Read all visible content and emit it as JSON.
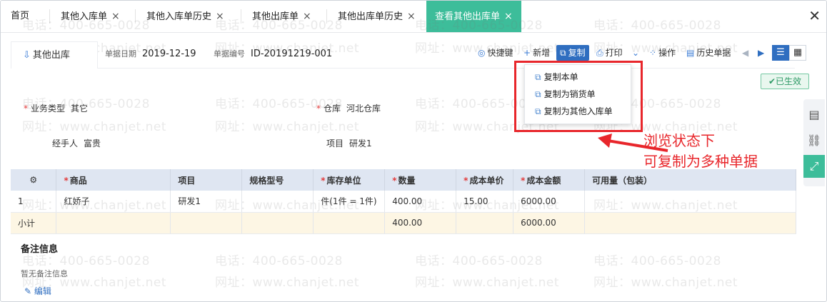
{
  "tabs": [
    {
      "label": "首页",
      "closable": false
    },
    {
      "label": "其他入库单",
      "closable": true
    },
    {
      "label": "其他入库单历史",
      "closable": true
    },
    {
      "label": "其他出库单",
      "closable": true
    },
    {
      "label": "其他出库单历史",
      "closable": true
    },
    {
      "label": "查看其他出库单",
      "closable": true,
      "active": true
    }
  ],
  "tab_close_glyph": "×",
  "window_close_glyph": "✕",
  "watermark": {
    "phone": "电话：400-665-0028",
    "site": "网址：www.chanjet.net"
  },
  "doc": {
    "title": "其他出库",
    "date_label": "单据日期",
    "date_value": "2019-12-19",
    "no_label": "单据编号",
    "no_value": "ID-20191219-001",
    "status": "已生效"
  },
  "toolbar": {
    "shortcut": "快捷键",
    "new": "新增",
    "copy": "复制",
    "print": "打印",
    "operate": "操作",
    "history": "历史单据"
  },
  "copy_menu": {
    "items": [
      "复制本单",
      "复制为销货单",
      "复制为其他入库单"
    ]
  },
  "fields": {
    "biz_type_label": "业务类型",
    "biz_type_value": "其它",
    "warehouse_label": "仓库",
    "warehouse_value": "河北仓库",
    "handler_label": "经手人",
    "handler_value": "富贵",
    "project_label": "项目",
    "project_value": "研发1"
  },
  "annotation": {
    "line1": "浏览状态下",
    "line2": "可复制为多种单据"
  },
  "table": {
    "columns": [
      "商品",
      "项目",
      "规格型号",
      "库存单位",
      "数量",
      "成本单价",
      "成本金额",
      "可用量（包装）"
    ],
    "required": [
      true,
      false,
      false,
      true,
      true,
      true,
      true,
      false
    ],
    "rows": [
      {
        "no": "1",
        "cells": [
          "红娇子",
          "研发1",
          "",
          "件(1件 = 1件)",
          "400.00",
          "15.00",
          "6000.00",
          ""
        ]
      }
    ],
    "subtotal": {
      "label": "小计",
      "qty": "400.00",
      "amount": "6000.00"
    }
  },
  "remarks": {
    "title": "备注信息",
    "empty": "暂无备注信息",
    "edit": "编辑"
  },
  "colors": {
    "accent": "#3dbd9a",
    "primary": "#2f6ec0",
    "highlight": "#e8262b"
  }
}
